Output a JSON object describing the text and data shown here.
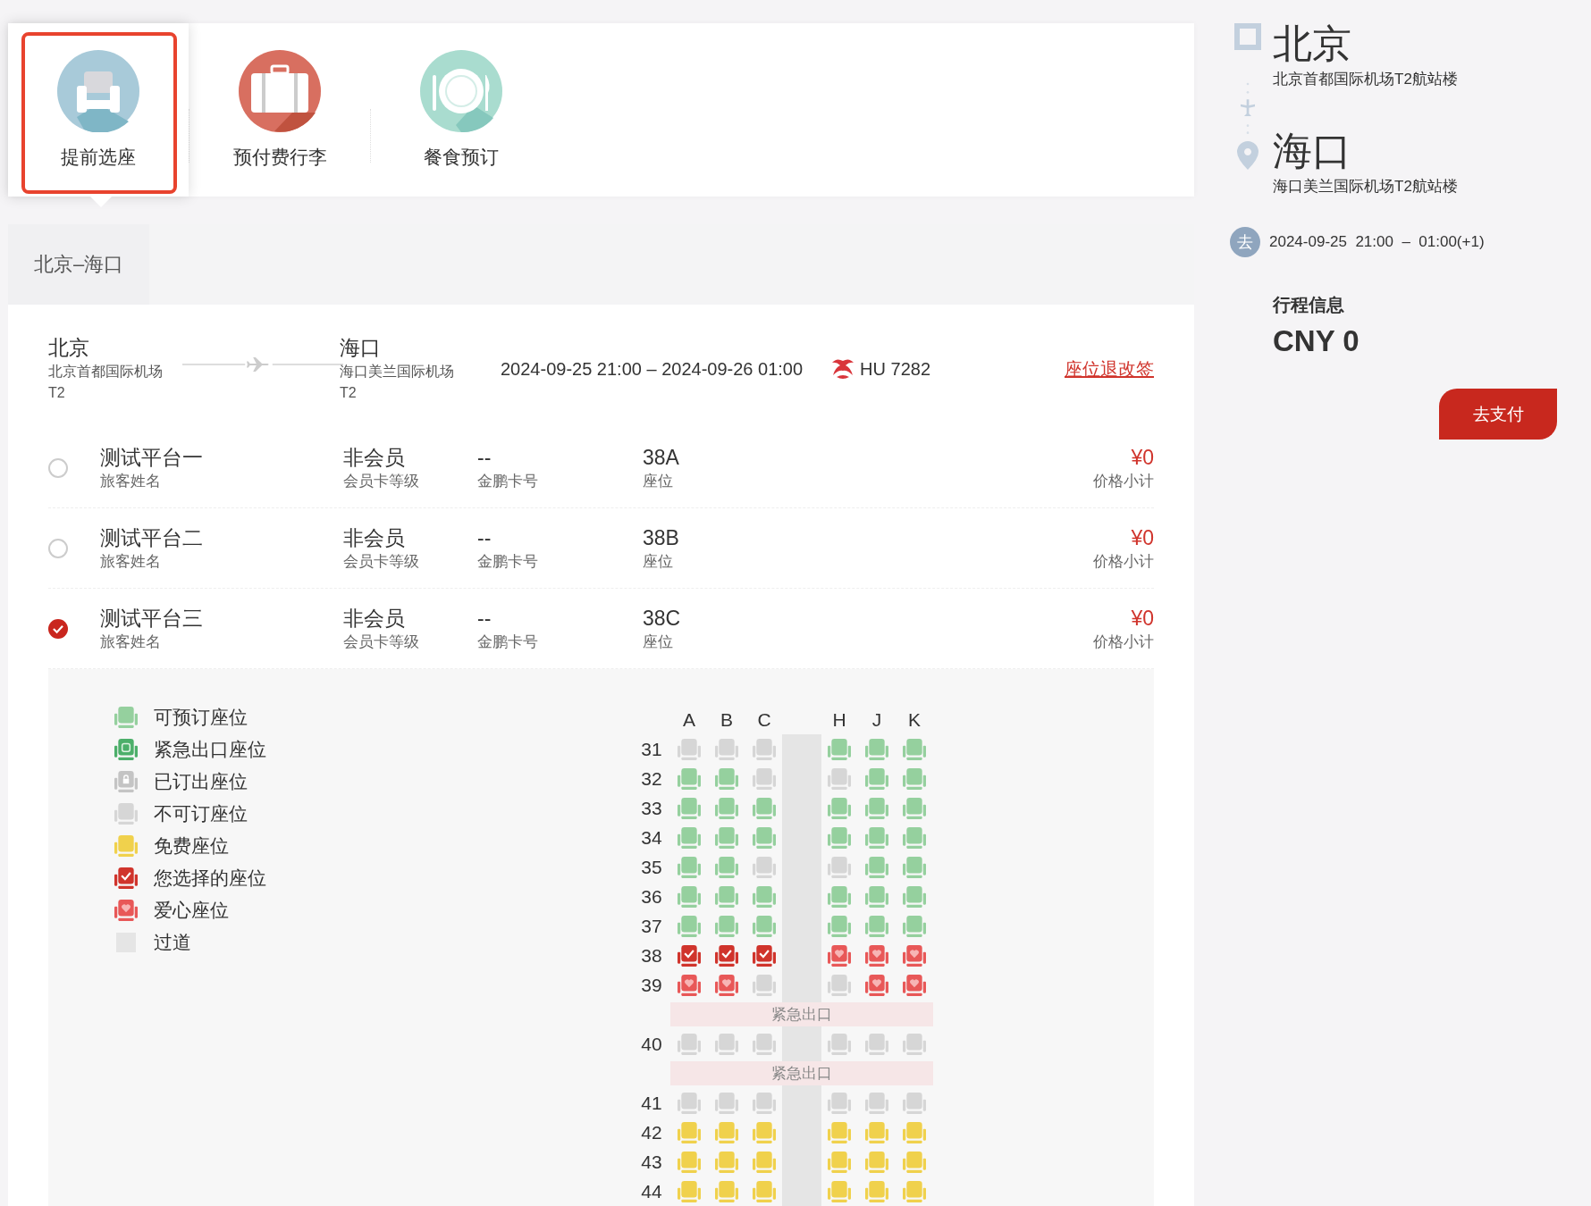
{
  "services": [
    {
      "label": "提前选座",
      "kind": "seat",
      "selected": true
    },
    {
      "label": "预付费行李",
      "kind": "luggage",
      "selected": false
    },
    {
      "label": "餐食预订",
      "kind": "meal",
      "selected": false
    }
  ],
  "route_tabs": [
    {
      "label": "北京–海口",
      "selected": true
    }
  ],
  "flight": {
    "from": {
      "city": "北京",
      "airport": "北京首都国际机场",
      "terminal": "T2"
    },
    "to": {
      "city": "海口",
      "airport": "海口美兰国际机场",
      "terminal": "T2"
    },
    "time": "2024-09-25 21:00 – 2024-09-26 01:00",
    "flight_no": "HU 7282",
    "policy_link": "座位退改签"
  },
  "passengers": [
    {
      "name": "测试平台一",
      "name_caption": "旅客姓名",
      "tier": "非会员",
      "tier_caption": "会员卡等级",
      "card_no": "--",
      "card_caption": "金鹏卡号",
      "seat": "38A",
      "seat_caption": "座位",
      "price": "¥0",
      "price_caption": "价格小计",
      "selected": false
    },
    {
      "name": "测试平台二",
      "name_caption": "旅客姓名",
      "tier": "非会员",
      "tier_caption": "会员卡等级",
      "card_no": "--",
      "card_caption": "金鹏卡号",
      "seat": "38B",
      "seat_caption": "座位",
      "price": "¥0",
      "price_caption": "价格小计",
      "selected": false
    },
    {
      "name": "测试平台三",
      "name_caption": "旅客姓名",
      "tier": "非会员",
      "tier_caption": "会员卡等级",
      "card_no": "--",
      "card_caption": "金鹏卡号",
      "seat": "38C",
      "seat_caption": "座位",
      "price": "¥0",
      "price_caption": "价格小计",
      "selected": true
    }
  ],
  "legend": [
    {
      "kind": "available",
      "label": "可预订座位"
    },
    {
      "kind": "emergency",
      "label": "紧急出口座位"
    },
    {
      "kind": "sold",
      "label": "已订出座位"
    },
    {
      "kind": "unavailable",
      "label": "不可订座位"
    },
    {
      "kind": "free",
      "label": "免费座位"
    },
    {
      "kind": "selected",
      "label": "您选择的座位"
    },
    {
      "kind": "love",
      "label": "爱心座位"
    },
    {
      "kind": "aisle",
      "label": "过道"
    }
  ],
  "seat_map": {
    "left_columns": [
      "A",
      "B",
      "C"
    ],
    "right_columns": [
      "H",
      "J",
      "K"
    ],
    "rows": [
      {
        "kind": "seats",
        "number": "31",
        "seats": [
          {
            "kind": "unavailable"
          },
          {
            "kind": "unavailable"
          },
          {
            "kind": "unavailable"
          },
          {
            "kind": "available"
          },
          {
            "kind": "available"
          },
          {
            "kind": "available"
          }
        ]
      },
      {
        "kind": "seats",
        "number": "32",
        "seats": [
          {
            "kind": "available"
          },
          {
            "kind": "available"
          },
          {
            "kind": "unavailable"
          },
          {
            "kind": "unavailable"
          },
          {
            "kind": "available"
          },
          {
            "kind": "available"
          }
        ]
      },
      {
        "kind": "seats",
        "number": "33",
        "seats": [
          {
            "kind": "available"
          },
          {
            "kind": "available"
          },
          {
            "kind": "available"
          },
          {
            "kind": "available"
          },
          {
            "kind": "available"
          },
          {
            "kind": "available"
          }
        ]
      },
      {
        "kind": "seats",
        "number": "34",
        "seats": [
          {
            "kind": "available"
          },
          {
            "kind": "available"
          },
          {
            "kind": "available"
          },
          {
            "kind": "available"
          },
          {
            "kind": "available"
          },
          {
            "kind": "available"
          }
        ]
      },
      {
        "kind": "seats",
        "number": "35",
        "seats": [
          {
            "kind": "available"
          },
          {
            "kind": "available"
          },
          {
            "kind": "unavailable"
          },
          {
            "kind": "unavailable"
          },
          {
            "kind": "available"
          },
          {
            "kind": "available"
          }
        ]
      },
      {
        "kind": "seats",
        "number": "36",
        "seats": [
          {
            "kind": "available"
          },
          {
            "kind": "available"
          },
          {
            "kind": "available"
          },
          {
            "kind": "available"
          },
          {
            "kind": "available"
          },
          {
            "kind": "available"
          }
        ]
      },
      {
        "kind": "seats",
        "number": "37",
        "seats": [
          {
            "kind": "available"
          },
          {
            "kind": "available"
          },
          {
            "kind": "available"
          },
          {
            "kind": "available"
          },
          {
            "kind": "available"
          },
          {
            "kind": "available"
          }
        ]
      },
      {
        "kind": "seats",
        "number": "38",
        "seats": [
          {
            "kind": "selected"
          },
          {
            "kind": "selected"
          },
          {
            "kind": "selected"
          },
          {
            "kind": "love"
          },
          {
            "kind": "love"
          },
          {
            "kind": "love"
          }
        ]
      },
      {
        "kind": "seats",
        "number": "39",
        "seats": [
          {
            "kind": "love"
          },
          {
            "kind": "love"
          },
          {
            "kind": "unavailable"
          },
          {
            "kind": "unavailable"
          },
          {
            "kind": "love"
          },
          {
            "kind": "love"
          }
        ]
      },
      {
        "kind": "exit",
        "label": "紧急出口"
      },
      {
        "kind": "seats",
        "number": "40",
        "seats": [
          {
            "kind": "unavailable"
          },
          {
            "kind": "unavailable"
          },
          {
            "kind": "unavailable"
          },
          {
            "kind": "unavailable"
          },
          {
            "kind": "unavailable"
          },
          {
            "kind": "unavailable"
          }
        ]
      },
      {
        "kind": "exit",
        "label": "紧急出口"
      },
      {
        "kind": "seats",
        "number": "41",
        "seats": [
          {
            "kind": "unavailable"
          },
          {
            "kind": "unavailable"
          },
          {
            "kind": "unavailable"
          },
          {
            "kind": "unavailable"
          },
          {
            "kind": "unavailable"
          },
          {
            "kind": "unavailable"
          }
        ]
      },
      {
        "kind": "seats",
        "number": "42",
        "seats": [
          {
            "kind": "free"
          },
          {
            "kind": "free"
          },
          {
            "kind": "free"
          },
          {
            "kind": "free"
          },
          {
            "kind": "free"
          },
          {
            "kind": "free"
          }
        ]
      },
      {
        "kind": "seats",
        "number": "43",
        "seats": [
          {
            "kind": "free"
          },
          {
            "kind": "free"
          },
          {
            "kind": "free"
          },
          {
            "kind": "free"
          },
          {
            "kind": "free"
          },
          {
            "kind": "free"
          }
        ]
      },
      {
        "kind": "seats",
        "number": "44",
        "seats": [
          {
            "kind": "free"
          },
          {
            "kind": "free"
          },
          {
            "kind": "free"
          },
          {
            "kind": "free"
          },
          {
            "kind": "free"
          },
          {
            "kind": "free"
          }
        ]
      }
    ]
  },
  "summary": {
    "from_city": "北京",
    "from_airport": "北京首都国际机场T2航站楼",
    "to_city": "海口",
    "to_airport": "海口美兰国际机场T2航站楼",
    "trip_badge": "去",
    "trip_time": "2024-09-25  21:00  –  01:00(+1)",
    "info_title": "行程信息",
    "total": "CNY 0",
    "pay_button": "去支付"
  }
}
